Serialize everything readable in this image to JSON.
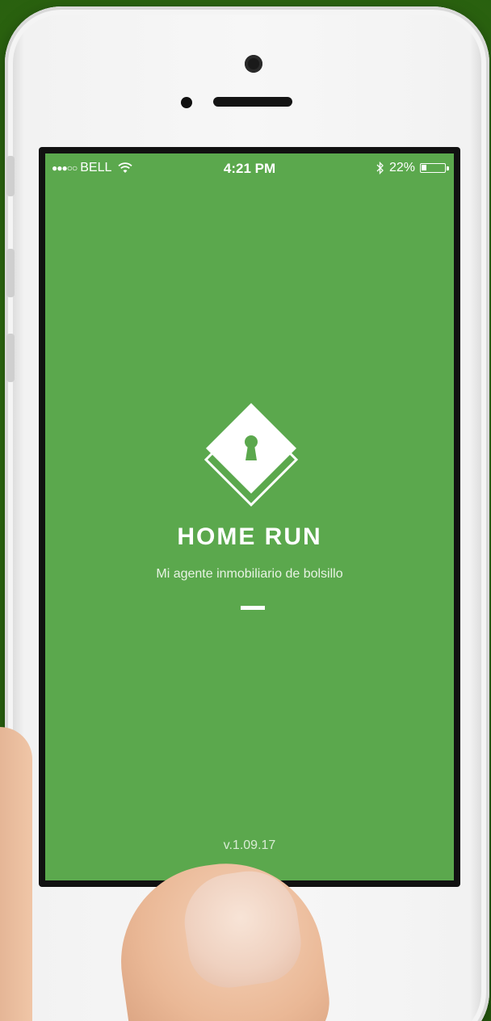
{
  "status_bar": {
    "signal": "●●●○○",
    "carrier": "BELL",
    "time": "4:21 PM",
    "battery_percent": "22%",
    "battery_level": 0.22,
    "icons": [
      "wifi-icon",
      "bluetooth-icon",
      "battery-icon"
    ]
  },
  "splash": {
    "logo_icon": "keyhole-diamond-icon",
    "title": "HOME RUN",
    "tagline": "Mi agente inmobiliario de bolsillo",
    "version": "v.1.09.17"
  },
  "colors": {
    "screen_background": "#5ba84d",
    "background": "#2f6a12",
    "text": "#ffffff"
  }
}
